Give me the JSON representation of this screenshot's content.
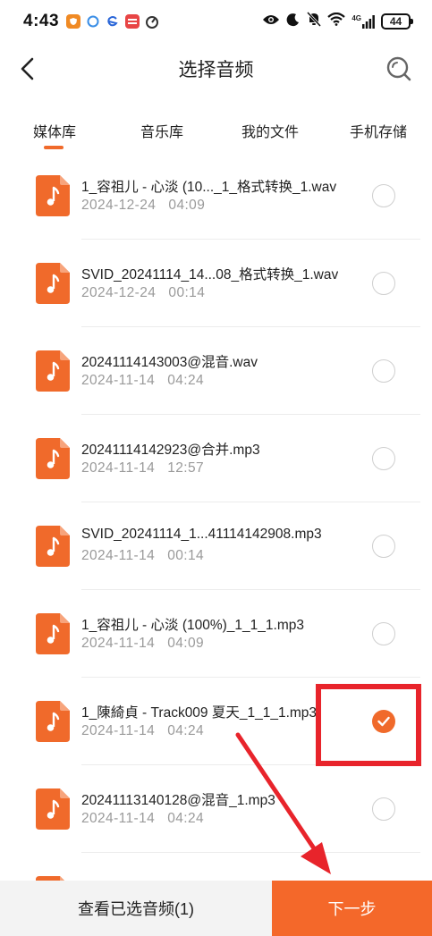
{
  "status_bar": {
    "time": "4:43",
    "network": "4G",
    "battery": "44"
  },
  "header": {
    "title": "选择音频",
    "back_icon": "chevron-left-icon",
    "search_icon": "search-icon"
  },
  "tabs": [
    {
      "label": "媒体库",
      "active": true
    },
    {
      "label": "音乐库",
      "active": false
    },
    {
      "label": "我的文件",
      "active": false
    },
    {
      "label": "手机存储",
      "active": false
    }
  ],
  "files": [
    {
      "name": "1_容祖儿 - 心淡 (10..._1_格式转换_1.wav",
      "date": "2024-12-24",
      "duration": "04:09",
      "selected": false
    },
    {
      "name": "SVID_20241114_14...08_格式转换_1.wav",
      "date": "2024-12-24",
      "duration": "00:14",
      "selected": false
    },
    {
      "name": "20241114143003@混音.wav",
      "date": "2024-11-14",
      "duration": "04:24",
      "selected": false
    },
    {
      "name": "20241114142923@合并.mp3",
      "date": "2024-11-14",
      "duration": "12:57",
      "selected": false
    },
    {
      "name": "SVID_20241114_1...41114142908.mp3",
      "date": "2024-11-14",
      "duration": "00:14",
      "selected": false
    },
    {
      "name": "1_容祖儿 - 心淡 (100%)_1_1_1.mp3",
      "date": "2024-11-14",
      "duration": "04:09",
      "selected": false
    },
    {
      "name": "1_陳綺貞 - Track009 夏天_1_1_1.mp3",
      "date": "2024-11-14",
      "duration": "04:24",
      "selected": true
    },
    {
      "name": "20241113140128@混音_1.mp3",
      "date": "2024-11-14",
      "duration": "04:24",
      "selected": false
    }
  ],
  "bottom": {
    "view_selected_label": "查看已选音频(1)",
    "next_label": "下一步"
  },
  "colors": {
    "accent": "#f06a2b",
    "annotation": "#e8242b"
  }
}
